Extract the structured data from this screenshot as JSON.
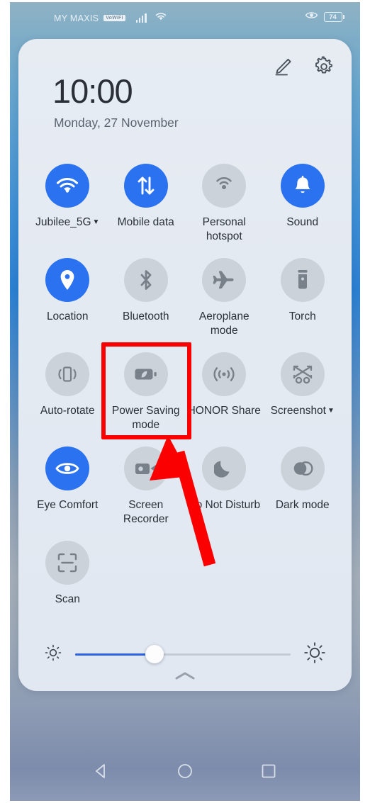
{
  "status_bar": {
    "carrier": "MY MAXIS",
    "carrier_badge": "VoWiFi",
    "signal_icon": "cellular-signal-icon",
    "wifi_icon": "wifi-icon",
    "eye_icon": "eye-comfort-indicator-icon",
    "battery_percent": "74"
  },
  "panel": {
    "edit_icon": "pencil-edit-icon",
    "settings_icon": "gear-settings-icon",
    "time": "10:00",
    "date": "Monday, 27 November",
    "collapse_icon": "chevron-up-icon"
  },
  "tiles": [
    {
      "label": "Jubilee_5G",
      "icon": "wifi-icon",
      "state": "on",
      "has_caret": true
    },
    {
      "label": "Mobile data",
      "icon": "mobile-data-icon",
      "state": "on",
      "has_caret": false
    },
    {
      "label": "Personal hotspot",
      "icon": "hotspot-icon",
      "state": "off",
      "has_caret": false
    },
    {
      "label": "Sound",
      "icon": "bell-sound-icon",
      "state": "on",
      "has_caret": false
    },
    {
      "label": "Location",
      "icon": "location-pin-icon",
      "state": "on",
      "has_caret": false
    },
    {
      "label": "Bluetooth",
      "icon": "bluetooth-icon",
      "state": "off",
      "has_caret": false
    },
    {
      "label": "Aeroplane mode",
      "icon": "airplane-icon",
      "state": "off",
      "has_caret": false
    },
    {
      "label": "Torch",
      "icon": "flashlight-icon",
      "state": "off",
      "has_caret": false
    },
    {
      "label": "Auto-rotate",
      "icon": "auto-rotate-icon",
      "state": "off",
      "has_caret": false
    },
    {
      "label": "Power Saving mode",
      "icon": "battery-leaf-icon",
      "state": "off",
      "has_caret": false
    },
    {
      "label": "HONOR Share",
      "icon": "honor-share-icon",
      "state": "off",
      "has_caret": false
    },
    {
      "label": "Screenshot",
      "icon": "screenshot-icon",
      "state": "off",
      "has_caret": true
    },
    {
      "label": "Eye Comfort",
      "icon": "eye-icon",
      "state": "on",
      "has_caret": false
    },
    {
      "label": "Screen Recorder",
      "icon": "video-camera-icon",
      "state": "off",
      "has_caret": false
    },
    {
      "label": "Do Not Disturb",
      "icon": "moon-icon",
      "state": "off",
      "has_caret": false
    },
    {
      "label": "Dark mode",
      "icon": "dark-mode-icon",
      "state": "off",
      "has_caret": false
    },
    {
      "label": "Scan",
      "icon": "scan-frame-icon",
      "state": "off",
      "has_caret": false
    }
  ],
  "brightness": {
    "low_icon": "brightness-low-icon",
    "high_icon": "brightness-high-icon",
    "value_percent": 37
  },
  "nav_bar": {
    "back_icon": "back-triangle-icon",
    "home_icon": "home-circle-icon",
    "recents_icon": "recents-square-icon"
  },
  "annotations": {
    "highlight_color": "#fb0000",
    "highlight_target": "Power Saving mode",
    "arrow_color": "#fb0000"
  },
  "colors": {
    "accent_blue": "#2a72f0",
    "tile_off": "#ccd2d9",
    "panel_bg": "#e4eaf2",
    "text_primary": "#2b3038",
    "text_secondary": "#5b6470"
  }
}
